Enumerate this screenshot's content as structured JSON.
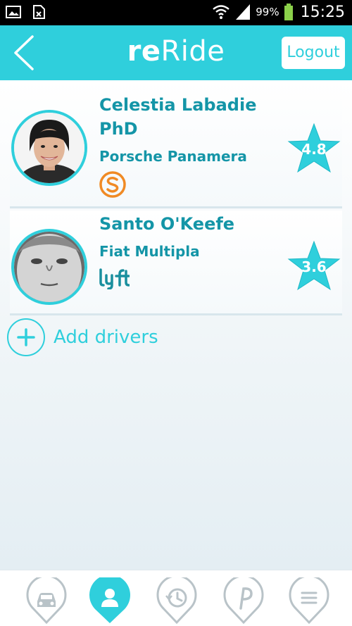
{
  "status_bar": {
    "battery_percent": "99%",
    "time": "15:25",
    "icons": [
      "image-icon",
      "sim-card-icon",
      "wifi-icon",
      "signal-icon",
      "battery-icon"
    ]
  },
  "header": {
    "title_bold": "re",
    "title_light": "Ride",
    "back_icon": "chevron-left-icon",
    "logout_label": "Logout"
  },
  "drivers": [
    {
      "name": "Celestia Labadie PhD",
      "car": "Porsche Panamera",
      "rating": "4.8",
      "service_icon": "sidecar-icon"
    },
    {
      "name": "Santo O'Keefe",
      "car": "Fiat Multipla",
      "rating": "3.6",
      "service_icon": "lyft-icon"
    }
  ],
  "add_drivers": {
    "label": "Add drivers",
    "icon": "plus-icon"
  },
  "bottom_nav": {
    "items": [
      "car-icon",
      "user-icon",
      "history-icon",
      "parking-icon",
      "menu-icon"
    ],
    "active": "user-icon"
  },
  "colors": {
    "accent": "#2fcfdc",
    "text_primary": "#1495a7",
    "sidecar_orange": "#f08a24",
    "lyft_teal": "#1a8f9e",
    "nav_gray": "#b9c3c8"
  }
}
